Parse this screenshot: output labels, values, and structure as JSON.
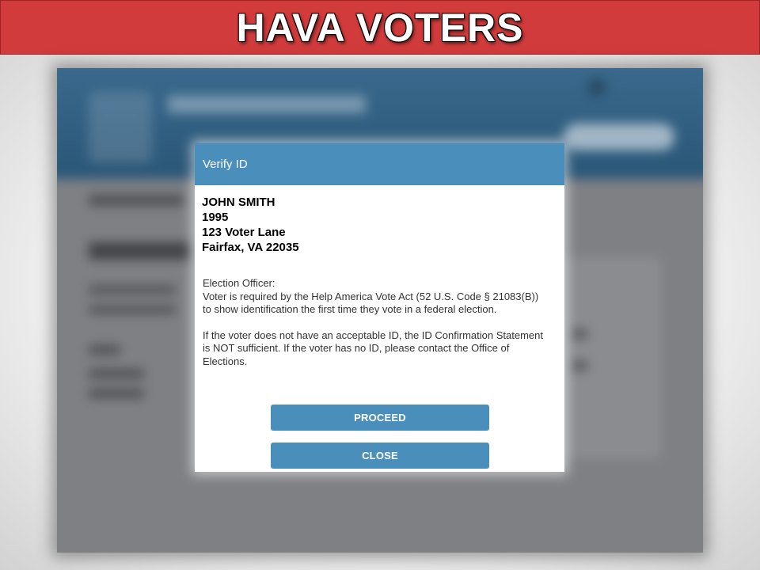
{
  "banner": {
    "title": "HAVA VOTERS"
  },
  "modal": {
    "title": "Verify ID",
    "voter": {
      "name": "JOHN SMITH",
      "year": "1995",
      "street": "123 Voter Lane",
      "city_state_zip": "Fairfax, VA 22035"
    },
    "notice": {
      "heading": "Election Officer:",
      "paragraph1": "Voter is required by the Help America Vote Act (52 U.S. Code § 21083(B)) to show identification the first time they vote in a federal election.",
      "paragraph2": "If the voter does not have an acceptable ID, the ID Confirmation Statement is NOT sufficient. If the voter has no ID, please contact the Office of Elections."
    },
    "buttons": {
      "proceed": "PROCEED",
      "close": "CLOSE"
    }
  },
  "colors": {
    "banner_red": "#d13b3b",
    "accent_blue": "#4a8fbb",
    "app_header_blue": "#2f5f83"
  }
}
